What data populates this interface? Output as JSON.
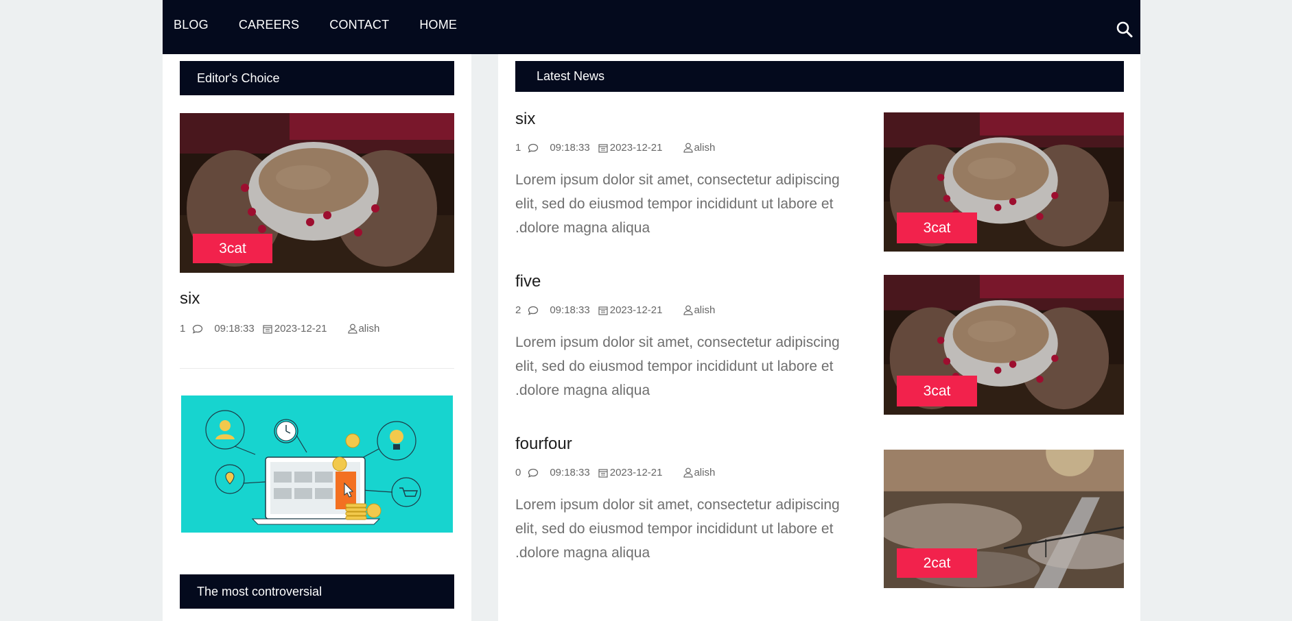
{
  "nav": {
    "items": [
      "BLOG",
      "CAREERS",
      "CONTACT",
      "HOME"
    ],
    "search_icon": "search-icon"
  },
  "sidebar": {
    "editors_choice_title": "Editor's Choice",
    "featured": {
      "category": "3cat",
      "title": "six",
      "comments": "1",
      "time": "09:18:33",
      "date": "2023-12-21",
      "author": "alish"
    },
    "controversial_title": "The most controversial"
  },
  "main": {
    "latest_title": "Latest News",
    "posts": [
      {
        "title": "six",
        "comments": "1",
        "time": "09:18:33",
        "date": "2023-12-21",
        "author": "alish",
        "excerpt": "Lorem ipsum dolor sit amet, consectetur adipiscing elit, sed do eiusmod tempor incididunt ut labore et .dolore magna aliqua",
        "category": "3cat"
      },
      {
        "title": "five",
        "comments": "2",
        "time": "09:18:33",
        "date": "2023-12-21",
        "author": "alish",
        "excerpt": "Lorem ipsum dolor sit amet, consectetur adipiscing elit, sed do eiusmod tempor incididunt ut labore et .dolore magna aliqua",
        "category": "3cat"
      },
      {
        "title": "fourfour",
        "comments": "0",
        "time": "09:18:33",
        "date": "2023-12-21",
        "author": "alish",
        "excerpt": "Lorem ipsum dolor sit amet, consectetur adipiscing elit, sed do eiusmod tempor incididunt ut labore et .dolore magna aliqua",
        "category": "2cat"
      }
    ]
  },
  "colors": {
    "header": "#040a1d",
    "accent": "#f2224c",
    "page_bg": "#edf0f1"
  }
}
